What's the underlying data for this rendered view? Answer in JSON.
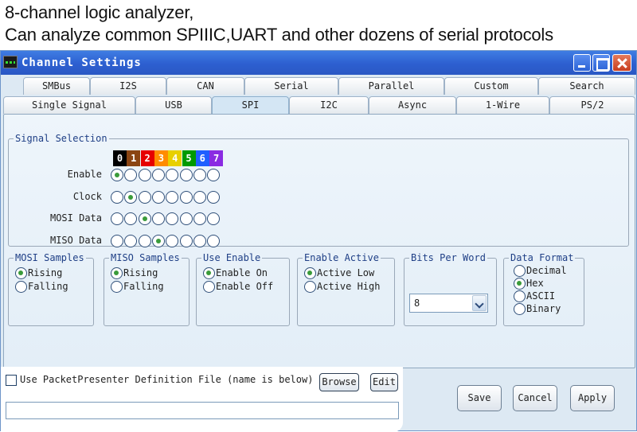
{
  "captions": {
    "line1": "8-channel logic analyzer,",
    "line2": "Can analyze common SPIIIC,UART and other dozens of serial protocols"
  },
  "window": {
    "title": "Channel Settings",
    "controls": {
      "minimize_icon": "minimize-icon",
      "maximize_icon": "maximize-icon",
      "close_icon": "close-icon"
    }
  },
  "tabs": {
    "row1": [
      "SMBus",
      "I2S",
      "CAN",
      "Serial",
      "Parallel",
      "Custom",
      "Search"
    ],
    "row2": [
      "Single Signal",
      "USB",
      "SPI",
      "I2C",
      "Async",
      "1-Wire",
      "PS/2"
    ],
    "active": "SPI"
  },
  "signal_selection": {
    "legend": "Signal Selection",
    "channels": [
      "0",
      "1",
      "2",
      "3",
      "4",
      "5",
      "6",
      "7"
    ],
    "channel_colors": [
      "#000000",
      "#8b4513",
      "#e60000",
      "#ff8c00",
      "#e8d000",
      "#009a00",
      "#1f5fff",
      "#8a2be2"
    ],
    "rows": [
      {
        "label": "Enable",
        "selected": 0
      },
      {
        "label": "Clock",
        "selected": 1
      },
      {
        "label": "MOSI Data",
        "selected": 2
      },
      {
        "label": "MISO Data",
        "selected": 3
      }
    ]
  },
  "groups": {
    "mosi_samples": {
      "legend": "MOSI Samples",
      "options": [
        "Rising",
        "Falling"
      ],
      "selected": 0
    },
    "miso_samples": {
      "legend": "MISO Samples",
      "options": [
        "Rising",
        "Falling"
      ],
      "selected": 0
    },
    "use_enable": {
      "legend": "Use Enable",
      "options": [
        "Enable On",
        "Enable Off"
      ],
      "selected": 0
    },
    "enable_active": {
      "legend": "Enable Active",
      "options": [
        "Active Low",
        "Active High"
      ],
      "selected": 0
    },
    "bits_per_word": {
      "legend": "Bits Per Word",
      "value": "8"
    },
    "data_format": {
      "legend": "Data Format",
      "options": [
        "Decimal",
        "Hex",
        "ASCII",
        "Binary"
      ],
      "selected": 1
    }
  },
  "packet_presenter": {
    "checkbox_label": "Use PacketPresenter Definition File (name is below)",
    "checked": false,
    "browse_label": "Browse",
    "edit_label": "Edit",
    "path_value": ""
  },
  "buttons": {
    "save": "Save",
    "cancel": "Cancel",
    "apply": "Apply"
  }
}
